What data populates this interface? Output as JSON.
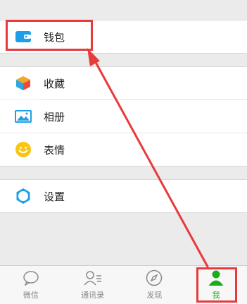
{
  "menu": {
    "wallet": {
      "label": "钱包",
      "icon": "wallet-icon"
    },
    "favorites": {
      "label": "收藏",
      "icon": "cube-icon"
    },
    "album": {
      "label": "相册",
      "icon": "image-icon"
    },
    "stickers": {
      "label": "表情",
      "icon": "smiley-icon"
    },
    "settings": {
      "label": "设置",
      "icon": "gear-icon"
    }
  },
  "tabs": [
    {
      "label": "微信",
      "icon": "chat-bubble-icon"
    },
    {
      "label": "通讯录",
      "icon": "contacts-icon"
    },
    {
      "label": "发现",
      "icon": "compass-icon"
    },
    {
      "label": "我",
      "icon": "person-icon",
      "active": true
    }
  ],
  "colors": {
    "accent": "#1aad19",
    "highlight": "#e8393b",
    "icon_blue": "#1e9ee8"
  }
}
